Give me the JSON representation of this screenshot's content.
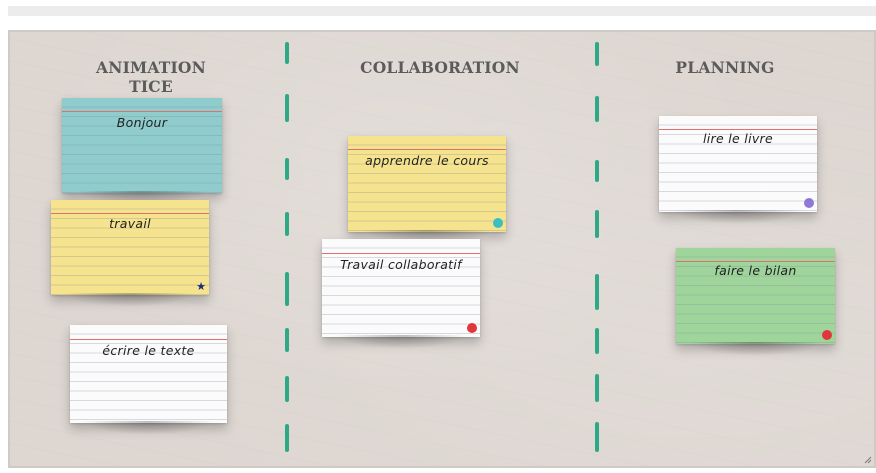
{
  "board": {
    "columns": [
      {
        "title": "ANIMATION TICE"
      },
      {
        "title": "COLLABORATION"
      },
      {
        "title": "PLANNING"
      }
    ],
    "cards": [
      {
        "text": "Bonjour",
        "color": "#8fcccb",
        "marker": "none"
      },
      {
        "text": "travail",
        "color": "#f6e38d",
        "marker": "star-icon",
        "marker_color": "#1f2a7a"
      },
      {
        "text": "écrire le texte",
        "color": "#fbfbfb",
        "marker": "none"
      },
      {
        "text": "apprendre le cours",
        "color": "#f6e38d",
        "marker": "dot",
        "marker_color": "#3bbfc0"
      },
      {
        "text": "Travail collaboratif",
        "color": "#fbfbfb",
        "marker": "dot",
        "marker_color": "#e0373a"
      },
      {
        "text": "lire le livre",
        "color": "#fbfbfb",
        "marker": "dot",
        "marker_color": "#8f78d8"
      },
      {
        "text": "faire le bilan",
        "color": "#9fd59b",
        "marker": "dot",
        "marker_color": "#e0373a"
      }
    ]
  }
}
